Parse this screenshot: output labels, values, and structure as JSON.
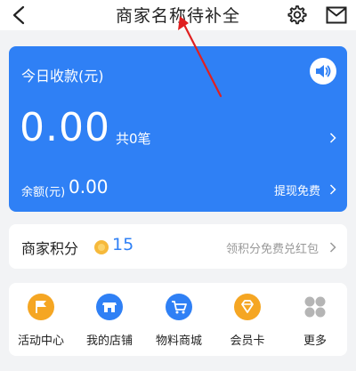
{
  "header": {
    "title": "商家名称待补全"
  },
  "income": {
    "title": "今日收款(元)",
    "amount": "0.00",
    "count": "共0笔",
    "balance_label": "余额(元)",
    "balance_value": "0.00",
    "withdraw": "提现免费"
  },
  "points": {
    "label": "商家积分",
    "value": "15",
    "link": "领积分免费兑红包"
  },
  "grid": {
    "items": [
      {
        "label": "活动中心",
        "icon": "flag-icon",
        "color": "#f5a623"
      },
      {
        "label": "我的店铺",
        "icon": "store-icon",
        "color": "#2f80f5"
      },
      {
        "label": "物料商城",
        "icon": "cart-icon",
        "color": "#2f80f5"
      },
      {
        "label": "会员卡",
        "icon": "diamond-icon",
        "color": "#f5a623"
      },
      {
        "label": "更多",
        "icon": "more-icon",
        "color": "#aaaaaa"
      }
    ]
  },
  "colors": {
    "primary": "#2f80f5",
    "accent": "#f5a623",
    "annotation": "#e02020"
  }
}
